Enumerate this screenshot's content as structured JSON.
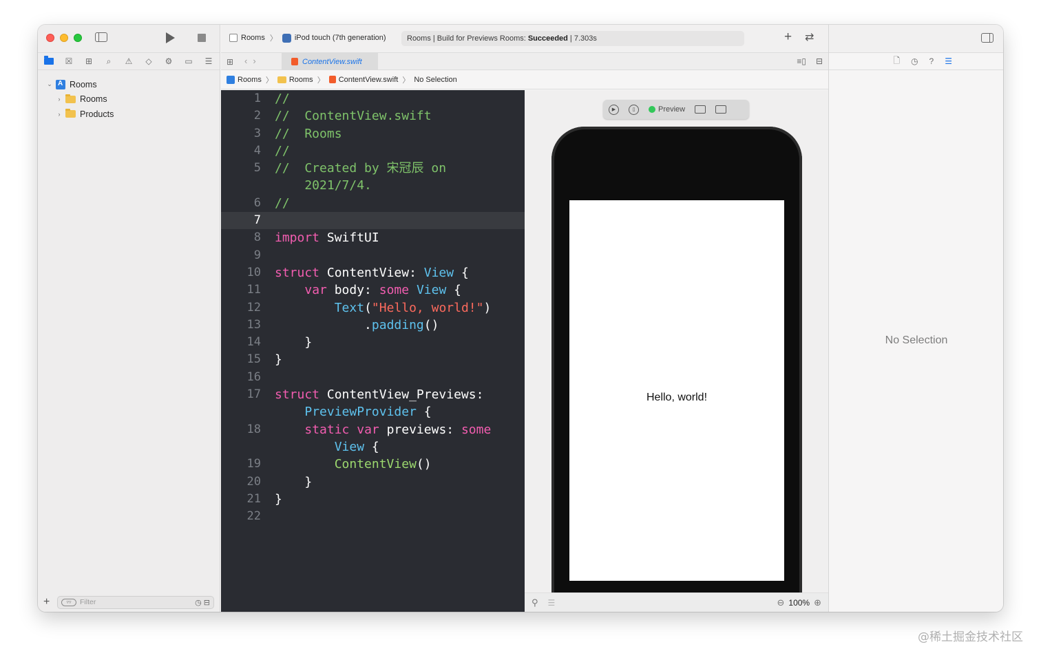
{
  "toolbar": {
    "scheme_project": "Rooms",
    "scheme_device": "iPod touch (7th generation)",
    "activity_prefix": "Rooms | Build for Previews Rooms:",
    "activity_status": "Succeeded",
    "activity_time": "| 7.303s",
    "add_icon": "plus-icon",
    "swap_icon": "swap-icon"
  },
  "navigator": {
    "tree": [
      {
        "label": "Rooms",
        "kind": "project",
        "expanded": true
      },
      {
        "label": "Rooms",
        "kind": "folder",
        "expanded": false
      },
      {
        "label": "Products",
        "kind": "folder",
        "expanded": false
      }
    ],
    "filter_placeholder": "Filter"
  },
  "tab": {
    "filename": "ContentView.swift"
  },
  "jumpbar": {
    "project": "Rooms",
    "folder": "Rooms",
    "file": "ContentView.swift",
    "selection": "No Selection"
  },
  "editor": {
    "active_line": 7,
    "lines": [
      {
        "n": "1",
        "tokens": [
          [
            "c-cmt",
            "//"
          ]
        ]
      },
      {
        "n": "2",
        "tokens": [
          [
            "c-cmt",
            "//  ContentView.swift"
          ]
        ]
      },
      {
        "n": "3",
        "tokens": [
          [
            "c-cmt",
            "//  Rooms"
          ]
        ]
      },
      {
        "n": "4",
        "tokens": [
          [
            "c-cmt",
            "//"
          ]
        ]
      },
      {
        "n": "5",
        "tokens": [
          [
            "c-cmt",
            "//  Created by 宋冠辰 on"
          ]
        ]
      },
      {
        "n": "",
        "tokens": [
          [
            "c-cmt",
            "    2021/7/4."
          ]
        ]
      },
      {
        "n": "6",
        "tokens": [
          [
            "c-cmt",
            "//"
          ]
        ]
      },
      {
        "n": "7",
        "tokens": []
      },
      {
        "n": "8",
        "tokens": [
          [
            "c-kw",
            "import"
          ],
          [
            "c-plain",
            " SwiftUI"
          ]
        ]
      },
      {
        "n": "9",
        "tokens": []
      },
      {
        "n": "10",
        "tokens": [
          [
            "c-kw",
            "struct"
          ],
          [
            "c-plain",
            " ContentView: "
          ],
          [
            "c-type",
            "View"
          ],
          [
            "c-plain",
            " {"
          ]
        ]
      },
      {
        "n": "11",
        "tokens": [
          [
            "c-plain",
            "    "
          ],
          [
            "c-kw",
            "var"
          ],
          [
            "c-plain",
            " body: "
          ],
          [
            "c-kw",
            "some"
          ],
          [
            "c-plain",
            " "
          ],
          [
            "c-type",
            "View"
          ],
          [
            "c-plain",
            " {"
          ]
        ]
      },
      {
        "n": "12",
        "tokens": [
          [
            "c-plain",
            "        "
          ],
          [
            "c-type",
            "Text"
          ],
          [
            "c-plain",
            "("
          ],
          [
            "c-str",
            "\"Hello, world!\""
          ],
          [
            "c-plain",
            ")"
          ]
        ]
      },
      {
        "n": "13",
        "tokens": [
          [
            "c-plain",
            "            ."
          ],
          [
            "c-type",
            "padding"
          ],
          [
            "c-plain",
            "()"
          ]
        ]
      },
      {
        "n": "14",
        "tokens": [
          [
            "c-plain",
            "    }"
          ]
        ]
      },
      {
        "n": "15",
        "tokens": [
          [
            "c-plain",
            "}"
          ]
        ]
      },
      {
        "n": "16",
        "tokens": []
      },
      {
        "n": "17",
        "tokens": [
          [
            "c-kw",
            "struct"
          ],
          [
            "c-plain",
            " ContentView_Previews:"
          ]
        ]
      },
      {
        "n": "",
        "tokens": [
          [
            "c-plain",
            "    "
          ],
          [
            "c-type",
            "PreviewProvider"
          ],
          [
            "c-plain",
            " {"
          ]
        ]
      },
      {
        "n": "18",
        "tokens": [
          [
            "c-plain",
            "    "
          ],
          [
            "c-kw",
            "static"
          ],
          [
            "c-plain",
            " "
          ],
          [
            "c-kw",
            "var"
          ],
          [
            "c-plain",
            " previews: "
          ],
          [
            "c-kw",
            "some"
          ]
        ]
      },
      {
        "n": "",
        "tokens": [
          [
            "c-plain",
            "        "
          ],
          [
            "c-type",
            "View"
          ],
          [
            "c-plain",
            " {"
          ]
        ]
      },
      {
        "n": "19",
        "tokens": [
          [
            "c-plain",
            "        "
          ],
          [
            "c-fn",
            "ContentView"
          ],
          [
            "c-plain",
            "()"
          ]
        ]
      },
      {
        "n": "20",
        "tokens": [
          [
            "c-plain",
            "    }"
          ]
        ]
      },
      {
        "n": "21",
        "tokens": [
          [
            "c-plain",
            "}"
          ]
        ]
      },
      {
        "n": "22",
        "tokens": []
      }
    ]
  },
  "preview": {
    "label": "Preview",
    "live_color": "#32c759",
    "text": "Hello, world!",
    "zoom": "100%"
  },
  "inspector": {
    "empty_text": "No Selection"
  },
  "watermark": "@稀土掘金技术社区",
  "colors": {
    "accent": "#1a73e8",
    "editor_bg": "#2a2c32",
    "keyword": "#f25db0",
    "type": "#5ec2ee",
    "comment": "#7fc36a",
    "string": "#fc6a5d"
  }
}
